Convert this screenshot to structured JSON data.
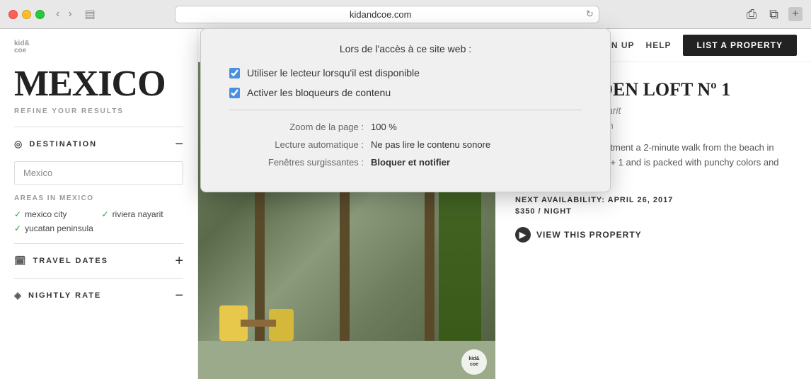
{
  "browser": {
    "url": "kidandcoe.com",
    "reload_icon": "↻",
    "share_icon": "⎙",
    "tabs_icon": "⧉",
    "back_icon": "‹",
    "forward_icon": "›",
    "sidebar_icon": "▤",
    "plus_icon": "+"
  },
  "popup": {
    "title": "Lors de l'accès à ce site web :",
    "checkboxes": [
      {
        "label": "Utiliser le lecteur lorsqu'il est disponible",
        "checked": true
      },
      {
        "label": "Activer les bloqueurs de contenu",
        "checked": true
      }
    ],
    "settings": [
      {
        "key": "Zoom de la page :",
        "value": "100 %",
        "bold": false
      },
      {
        "key": "Lecture automatique :",
        "value": "Ne pas lire le contenu sonore",
        "bold": false
      },
      {
        "key": "Fenêtres surgissantes :",
        "value": "Bloquer et notifier",
        "bold": true
      }
    ]
  },
  "sidebar": {
    "logo": "kid&",
    "logo_sub": "coe",
    "page_title": "MEXICO",
    "refine_label": "REFINE YOUR RESULTS",
    "destination_section": {
      "title": "DESTINATION",
      "icon": "◎",
      "toggle": "−",
      "input_value": "Mexico",
      "areas_label": "AREAS IN MEXICO",
      "areas": [
        {
          "label": "mexico city",
          "checked": true
        },
        {
          "label": "riviera nayarit",
          "checked": true
        },
        {
          "label": "yucatan peninsula",
          "checked": true
        }
      ]
    },
    "travel_dates_section": {
      "title": "TRAVEL DATES",
      "icon": "📅",
      "toggle": "+"
    },
    "nightly_rate_section": {
      "title": "NIGHTLY RATE",
      "icon": "◈",
      "toggle": "−"
    }
  },
  "nav": {
    "sign_up": "SIGN UP",
    "help": "HELP",
    "list_property": "LIST A PROPERTY"
  },
  "property": {
    "name": "THE GARDEN LOFT Nº 1",
    "location": "Sayulita, Riviera Nayarit",
    "rooms": "1 bedroom / 1 bathroom",
    "description": "This vibrant family apartment a 2-minute walk from the beach in Sayulita sleeps up to 4 + 1 and is packed with punchy colors and contemporary style.",
    "availability_label": "NEXT AVAILABILITY: APRIL 26, 2017",
    "price": "$350 / NIGHT",
    "view_button": "VIEW THIS PROPERTY",
    "badge": "kid&\ncoe"
  }
}
